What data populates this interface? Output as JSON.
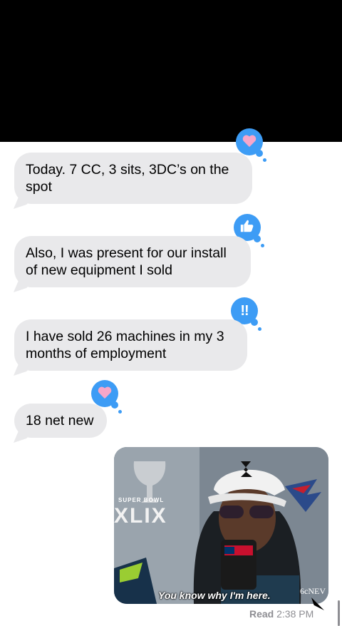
{
  "messages": [
    {
      "text": "Today. 7 CC, 3 sits, 3DC’s on the spot",
      "reaction": "heart-icon"
    },
    {
      "text": "Also, I was present for our install of new equipment I sold",
      "reaction": "thumbs-up-icon"
    },
    {
      "text": "I have sold 26 machines in my 3 months of employment",
      "reaction": "exclamation-icon",
      "reaction_text": "!!"
    },
    {
      "text": "18 net new",
      "reaction": "heart-icon"
    }
  ],
  "gif": {
    "caption": "You know why I'm here.",
    "logo_text": "XLIX",
    "super_bowl_text": "SUPER BOWL",
    "network_text": "6cNEV"
  },
  "status": {
    "read_label": "Read",
    "read_time": "2:38 PM"
  },
  "colors": {
    "bubble_gray": "#e9e9eb",
    "tapback_blue": "#3d9cf5",
    "heart_pink": "#f7a6c9"
  }
}
